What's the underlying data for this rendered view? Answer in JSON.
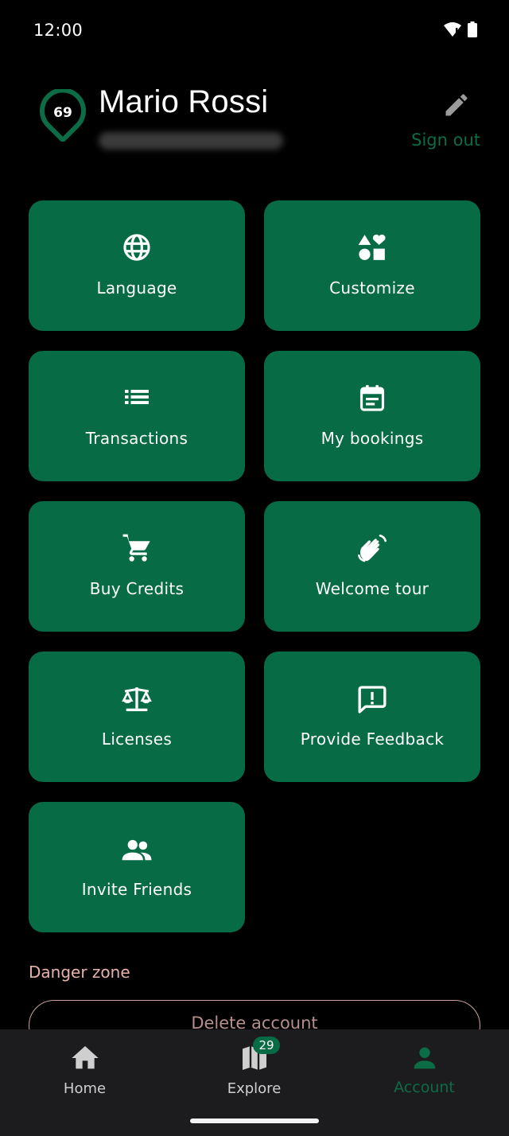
{
  "status_bar": {
    "time": "12:00"
  },
  "profile": {
    "level": "69",
    "name": "Mario Rossi",
    "sign_out_label": "Sign out"
  },
  "tiles": [
    {
      "label": "Language",
      "icon": "globe-icon"
    },
    {
      "label": "Customize",
      "icon": "shapes-icon"
    },
    {
      "label": "Transactions",
      "icon": "list-icon"
    },
    {
      "label": "My bookings",
      "icon": "calendar-icon"
    },
    {
      "label": "Buy Credits",
      "icon": "cart-icon"
    },
    {
      "label": "Welcome tour",
      "icon": "waving-hand-icon"
    },
    {
      "label": "Licenses",
      "icon": "balance-scale-icon"
    },
    {
      "label": "Provide Feedback",
      "icon": "feedback-icon"
    },
    {
      "label": "Invite Friends",
      "icon": "people-icon"
    }
  ],
  "danger_zone": {
    "title": "Danger zone",
    "delete_label": "Delete account"
  },
  "bottom_nav": {
    "items": [
      {
        "label": "Home",
        "icon": "home-icon"
      },
      {
        "label": "Explore",
        "icon": "map-icon",
        "badge": "29"
      },
      {
        "label": "Account",
        "icon": "person-icon",
        "active": true
      }
    ]
  },
  "colors": {
    "accent": "#076b45",
    "accent_text": "#0c6c45",
    "background": "#000000",
    "danger_text": "#e7b2ad",
    "nav_background": "#1c1c1e"
  }
}
